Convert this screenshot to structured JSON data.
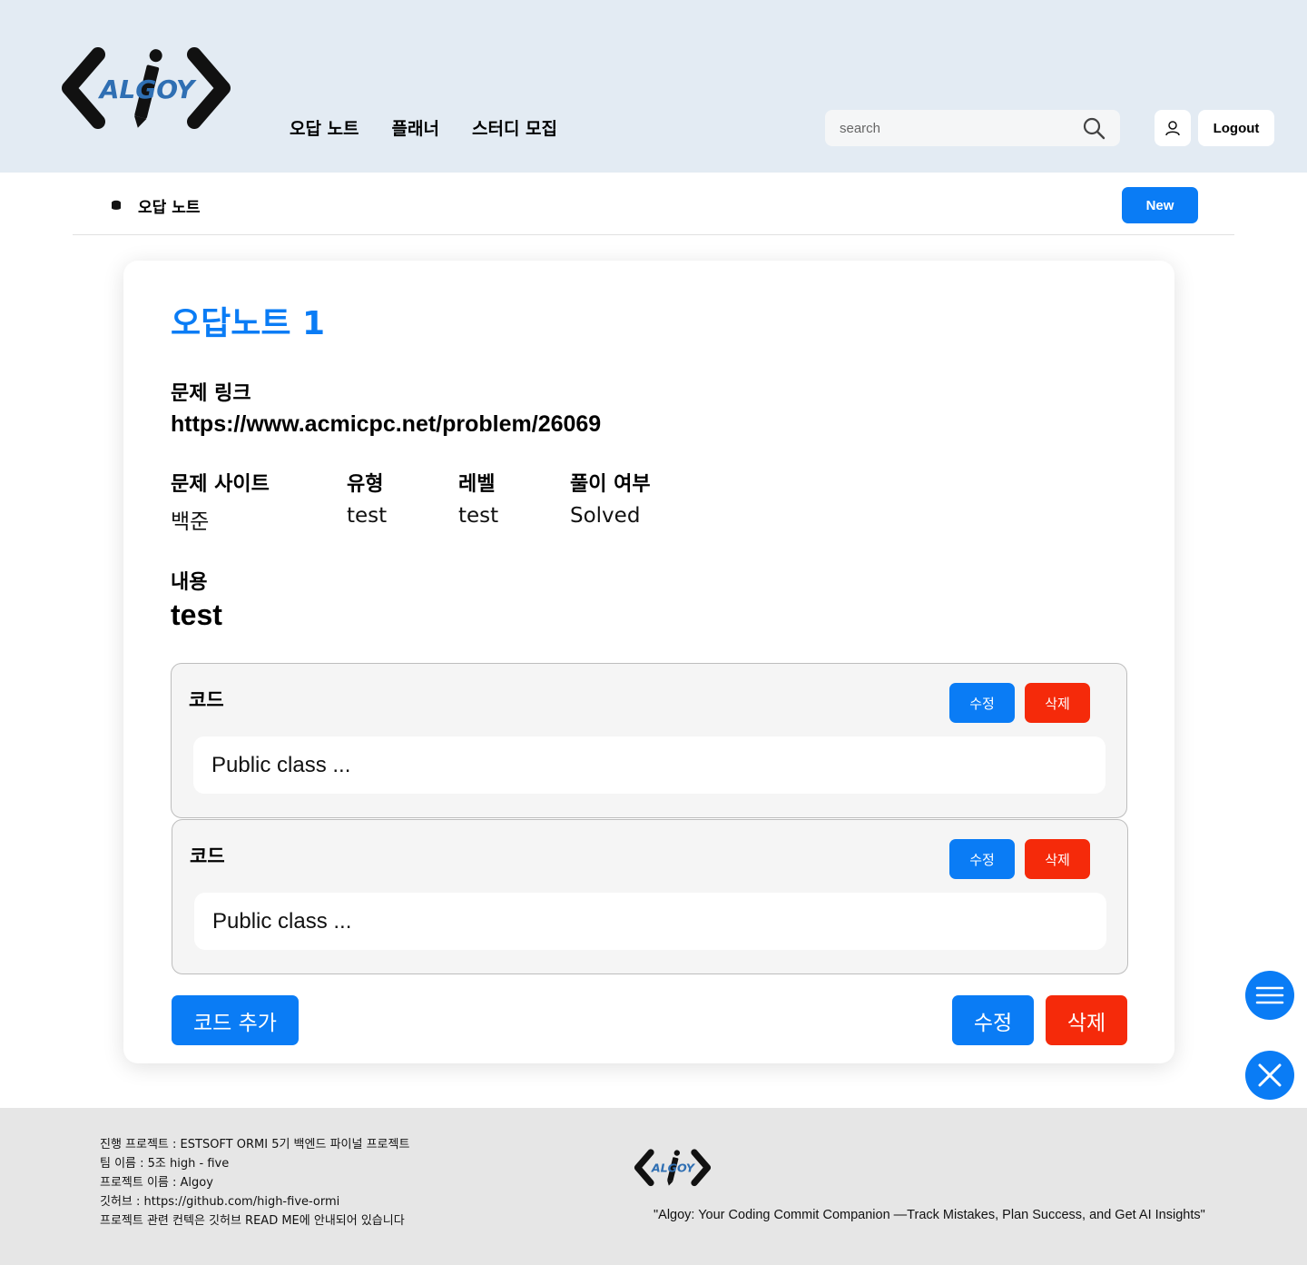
{
  "header": {
    "logo_text": "ALGOY",
    "nav": [
      "오답 노트",
      "플래너",
      "스터디 모집"
    ],
    "search_placeholder": "search",
    "logout_label": "Logout"
  },
  "subbar": {
    "title": "오답 노트",
    "new_label": "New"
  },
  "note": {
    "title": "오답노트 1",
    "link_label": "문제 링크",
    "link_value": "https://www.acmicpc.net/problem/26069",
    "fields": [
      {
        "label": "문제 사이트",
        "value": "백준"
      },
      {
        "label": "유형",
        "value": "test"
      },
      {
        "label": "레벨",
        "value": "test"
      },
      {
        "label": "풀이 여부",
        "value": "Solved"
      }
    ],
    "content_label": "내용",
    "content_value": "test",
    "codes": [
      {
        "label": "코드",
        "edit": "수정",
        "delete": "삭제",
        "code": "Public class ..."
      },
      {
        "label": "코드",
        "edit": "수정",
        "delete": "삭제",
        "code": "Public class ..."
      }
    ],
    "add_code_label": "코드 추가",
    "edit_label": "수정",
    "delete_label": "삭제"
  },
  "footer": {
    "lines": [
      "진행 프로젝트 : ESTSOFT ORMI 5기 백엔드 파이널 프로젝트",
      "팀 이름 : 5조 high - five",
      "프로젝트 이름 : Algoy",
      "깃허브 : https://github.com/high-five-ormi",
      "프로젝트 관련 컨텍은 깃허브 READ ME에 안내되어 있습니다"
    ],
    "logo_text": "ALGOY",
    "quote": "\"Algoy: Your Coding Commit Companion —Track Mistakes, Plan Success, and Get AI Insights\""
  },
  "colors": {
    "accent": "#0a7cf5",
    "danger": "#f52a0a",
    "header_bg": "#e3ebf3",
    "footer_bg": "#e6e6e6"
  },
  "icons": [
    "logo",
    "search-icon",
    "user-icon",
    "database-icon",
    "menu-icon",
    "close-icon"
  ]
}
